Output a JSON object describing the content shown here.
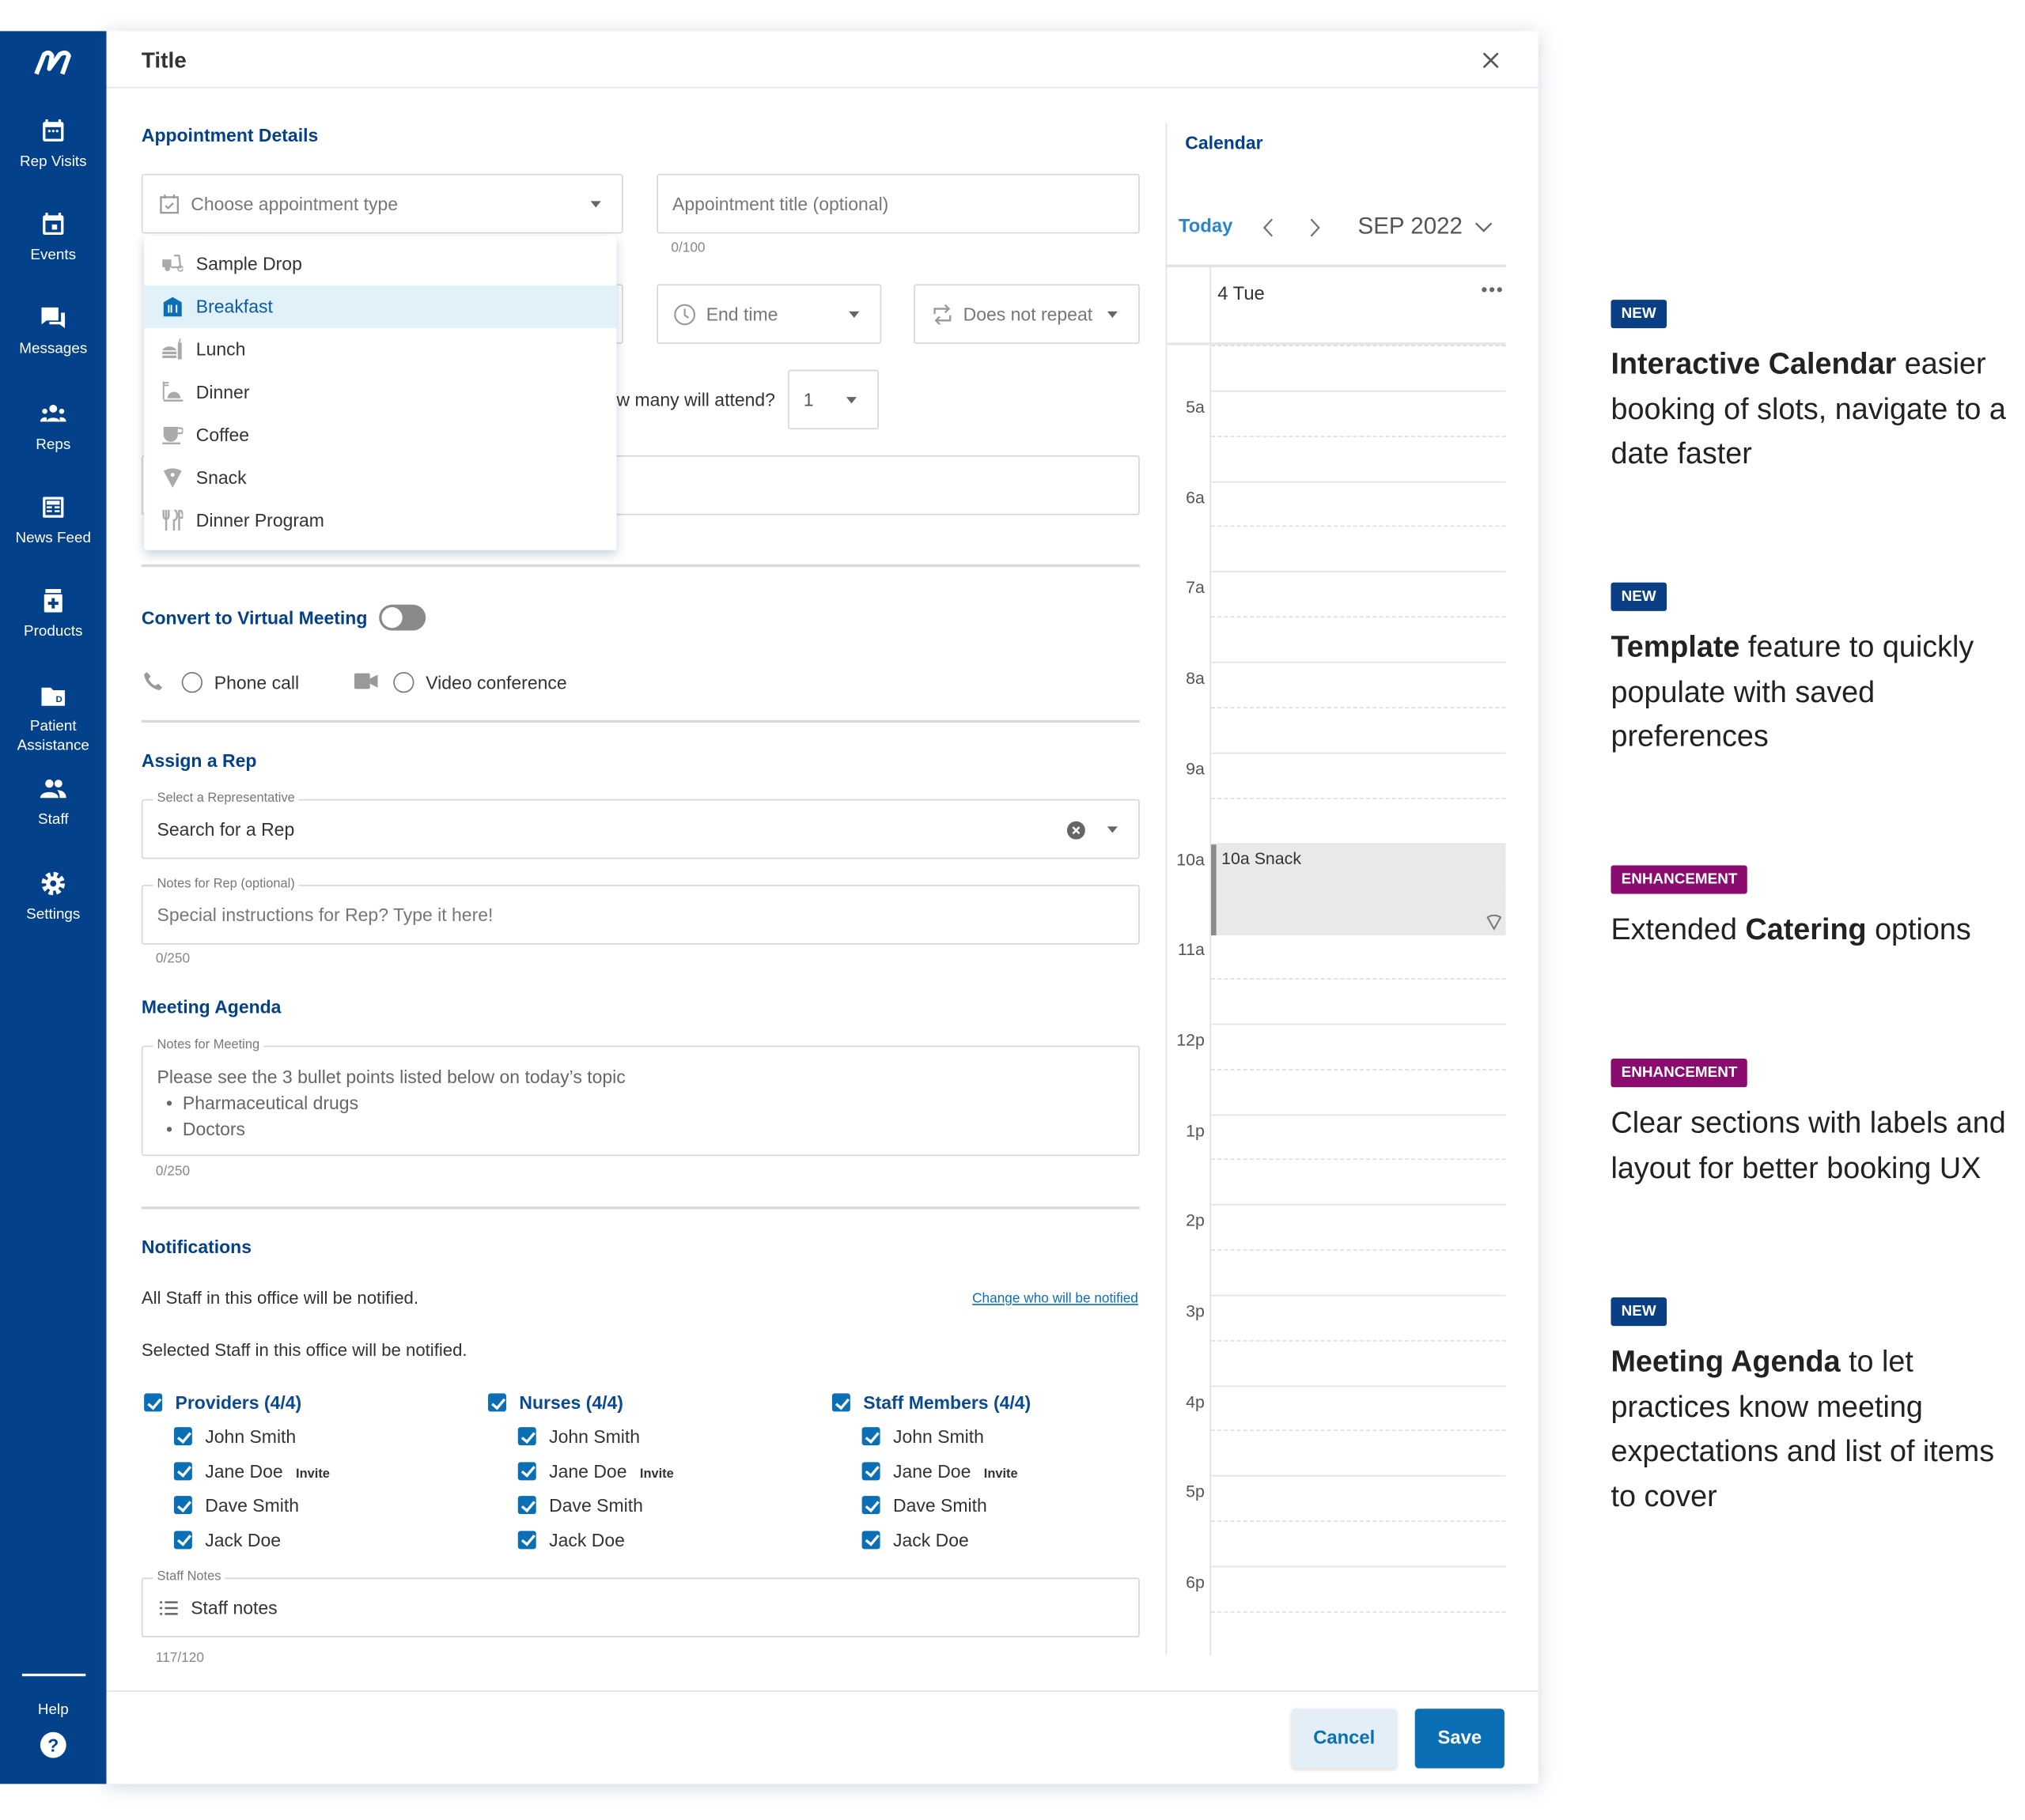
{
  "colors": {
    "sidebar": "#03428a",
    "accent": "#03428a",
    "primary_button": "#0a6fb5",
    "badge_new": "#0a3f85",
    "badge_enhancement": "#8a0c6e",
    "highlight": "#e1f1fa"
  },
  "sidebar": {
    "items": [
      {
        "label": "Rep Visits",
        "icon": "calendar-dots-icon"
      },
      {
        "label": "Events",
        "icon": "calendar-event-icon"
      },
      {
        "label": "Messages",
        "icon": "chat-icon"
      },
      {
        "label": "Reps",
        "icon": "group-icon"
      },
      {
        "label": "News Feed",
        "icon": "newspaper-icon"
      },
      {
        "label": "Products",
        "icon": "medicine-box-icon"
      },
      {
        "label": "Patient Assistance",
        "icon": "folder-icon"
      },
      {
        "label": "Staff",
        "icon": "people-icon"
      },
      {
        "label": "Settings",
        "icon": "gear-icon"
      }
    ],
    "help_label": "Help"
  },
  "modal": {
    "title": "Title"
  },
  "details": {
    "heading": "Appointment Details",
    "type_placeholder": "Choose appointment type",
    "title_placeholder": "Appointment title (optional)",
    "title_count": "0/100",
    "end_time": "End time",
    "repeat": "Does not repeat",
    "attend_label": "w many will attend?",
    "attend_value": "1"
  },
  "dropdown": {
    "selected": "Breakfast",
    "items": [
      {
        "label": "Sample Drop",
        "icon": "scooter-icon"
      },
      {
        "label": "Breakfast",
        "icon": "breakfast-icon"
      },
      {
        "label": "Lunch",
        "icon": "burger-drink-icon"
      },
      {
        "label": "Dinner",
        "icon": "dinner-cloche-icon"
      },
      {
        "label": "Coffee",
        "icon": "coffee-cup-icon"
      },
      {
        "label": "Snack",
        "icon": "pizza-slice-icon"
      },
      {
        "label": "Dinner Program",
        "icon": "utensils-icon"
      }
    ]
  },
  "virtual": {
    "label": "Convert to Virtual Meeting",
    "enabled": false,
    "phone": "Phone call",
    "video": "Video conference"
  },
  "rep": {
    "heading": "Assign a Rep",
    "select_label": "Select a Representative",
    "select_placeholder": "Search for a Rep",
    "notes_label": "Notes for Rep (optional)",
    "notes_placeholder": "Special instructions for Rep? Type it here!",
    "notes_count": "0/250"
  },
  "agenda": {
    "heading": "Meeting Agenda",
    "label": "Notes for Meeting",
    "intro": "Please see the 3 bullet points listed below on today’s topic",
    "bullets": [
      "Pharmaceutical drugs",
      "Doctors"
    ],
    "count": "0/250"
  },
  "notifications": {
    "heading": "Notifications",
    "all_text": "All Staff in this office will be notified.",
    "change_link": "Change who will be notified",
    "selected_text": "Selected Staff in this office will be notified.",
    "invite_label": "Invite",
    "groups": [
      {
        "title": "Providers (4/4)",
        "members": [
          {
            "name": "John Smith"
          },
          {
            "name": "Jane Doe",
            "invite": true
          },
          {
            "name": "Dave Smith"
          },
          {
            "name": "Jack Doe"
          }
        ]
      },
      {
        "title": "Nurses (4/4)",
        "members": [
          {
            "name": "John Smith"
          },
          {
            "name": "Jane Doe",
            "invite": true
          },
          {
            "name": "Dave Smith"
          },
          {
            "name": "Jack Doe"
          }
        ]
      },
      {
        "title": "Staff Members (4/4)",
        "members": [
          {
            "name": "John Smith"
          },
          {
            "name": "Jane Doe",
            "invite": true
          },
          {
            "name": "Dave Smith"
          },
          {
            "name": "Jack Doe"
          }
        ]
      }
    ],
    "staff_notes_label": "Staff Notes",
    "staff_notes_placeholder": "Staff notes",
    "staff_notes_count": "117/120"
  },
  "calendar": {
    "heading": "Calendar",
    "today": "Today",
    "month": "SEP 2022",
    "day": "4 Tue",
    "hours": [
      "5a",
      "6a",
      "7a",
      "8a",
      "9a",
      "10a",
      "11a",
      "12p",
      "1p",
      "2p",
      "3p",
      "4p",
      "5p",
      "6p"
    ],
    "event": {
      "label": "10a Snack",
      "icon": "pizza-slice-icon"
    }
  },
  "footer": {
    "cancel": "Cancel",
    "save": "Save"
  },
  "features": [
    {
      "badge": "NEW",
      "type": "new",
      "bold": "Interactive Calendar",
      "before": "",
      "after": " easier booking of slots, navigate to a date faster"
    },
    {
      "badge": "NEW",
      "type": "new",
      "bold": "Template",
      "before": "",
      "after": " feature to quickly populate with saved preferences"
    },
    {
      "badge": "ENHANCEMENT",
      "type": "enh",
      "bold": "Catering",
      "before": "Extended ",
      "after": " options"
    },
    {
      "badge": "ENHANCEMENT",
      "type": "enh",
      "bold": "",
      "before": "Clear sections with labels and layout for better booking UX",
      "after": ""
    },
    {
      "badge": "NEW",
      "type": "new",
      "bold": "Meeting Agenda",
      "before": "",
      "after": " to let practices know meeting expectations and list of items to cover"
    }
  ]
}
